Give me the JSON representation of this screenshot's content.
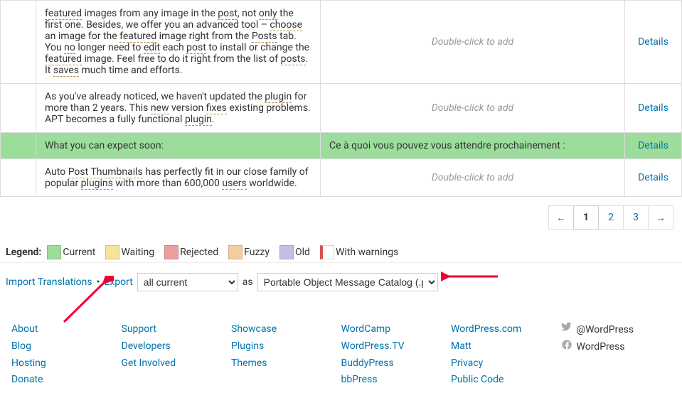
{
  "rows": [
    {
      "src_html": "<span class='dotted'>featured</span> images from any image in the <span class='dotted'>post</span>, not <span class='dotted'>only</span> the first one. Besides, we offer you an advanced tool – <span class='dotted'>choose</span>  an image for the <span class='dotted'>featured</span> image right from the <span class='dotted'>Posts</span> tab. You <span class='dotted'>no</span> longer need to <span class='dotted'>edit</span> each <span class='dotted'>post</span> to install or change the <span class='dotted'>featured</span> image. Feel free to do it right from the list of <span class='dotted'>posts</span>. It <span class='dotted'>saves</span> much time and efforts.",
      "tgt": "Double-click to add",
      "tgt_placeholder": true,
      "action": "Details",
      "highlight": false
    },
    {
      "src_html": "As you've already noticed, we haven't updated the <span class='dotted'>plugin</span>  for more than 2 years. This <span class='dotted'>new</span> version <span class='dotted'>fixes</span> existing problems. APT becomes a fully functional <span class='dotted'>plugin</span>.",
      "tgt": "Double-click to add",
      "tgt_placeholder": true,
      "action": "Details",
      "highlight": false
    },
    {
      "src_html": "What you can expect soon:",
      "tgt": "Ce à quoi vous pouvez vous attendre prochainement :",
      "tgt_placeholder": false,
      "action": "Details",
      "highlight": true
    },
    {
      "src_html": "Auto <span class='dotted'>Post Thumbnails</span> has perfectly fit in our close family of popular <span class='dotted'>plugins</span> with more than 600,000 <span class='dotted'>users</span> worldwide.",
      "tgt": "Double-click to add",
      "tgt_placeholder": true,
      "action": "Details",
      "highlight": false
    }
  ],
  "pagination": {
    "prev": "←",
    "pages": [
      "1",
      "2",
      "3"
    ],
    "current": "1",
    "next": "→"
  },
  "legend": {
    "label": "Legend:",
    "items": [
      {
        "cls": "sw-current",
        "label": "Current"
      },
      {
        "cls": "sw-waiting",
        "label": "Waiting"
      },
      {
        "cls": "sw-rejected",
        "label": "Rejected"
      },
      {
        "cls": "sw-fuzzy",
        "label": "Fuzzy"
      },
      {
        "cls": "sw-old",
        "label": "Old"
      },
      {
        "cls": "sw-warn",
        "label": "With warnings"
      }
    ]
  },
  "export": {
    "import_link": "Import Translations",
    "export_link": "Export",
    "sep": "•",
    "sel1": "all current",
    "as_label": "as",
    "sel2": "Portable Object Message Catalog (.po/.pot)"
  },
  "footer": {
    "col1": [
      "About",
      "Blog",
      "Hosting",
      "Donate"
    ],
    "col2": [
      "Support",
      "Developers",
      "Get Involved"
    ],
    "col3": [
      "Showcase",
      "Plugins",
      "Themes"
    ],
    "col4": [
      "WordCamp",
      "WordPress.TV",
      "BuddyPress",
      "bbPress"
    ],
    "col5": [
      "WordPress.com",
      "Matt",
      "Privacy",
      "Public Code"
    ],
    "social": [
      {
        "icon": "twitter",
        "label": "@WordPress"
      },
      {
        "icon": "facebook",
        "label": "WordPress"
      }
    ]
  }
}
